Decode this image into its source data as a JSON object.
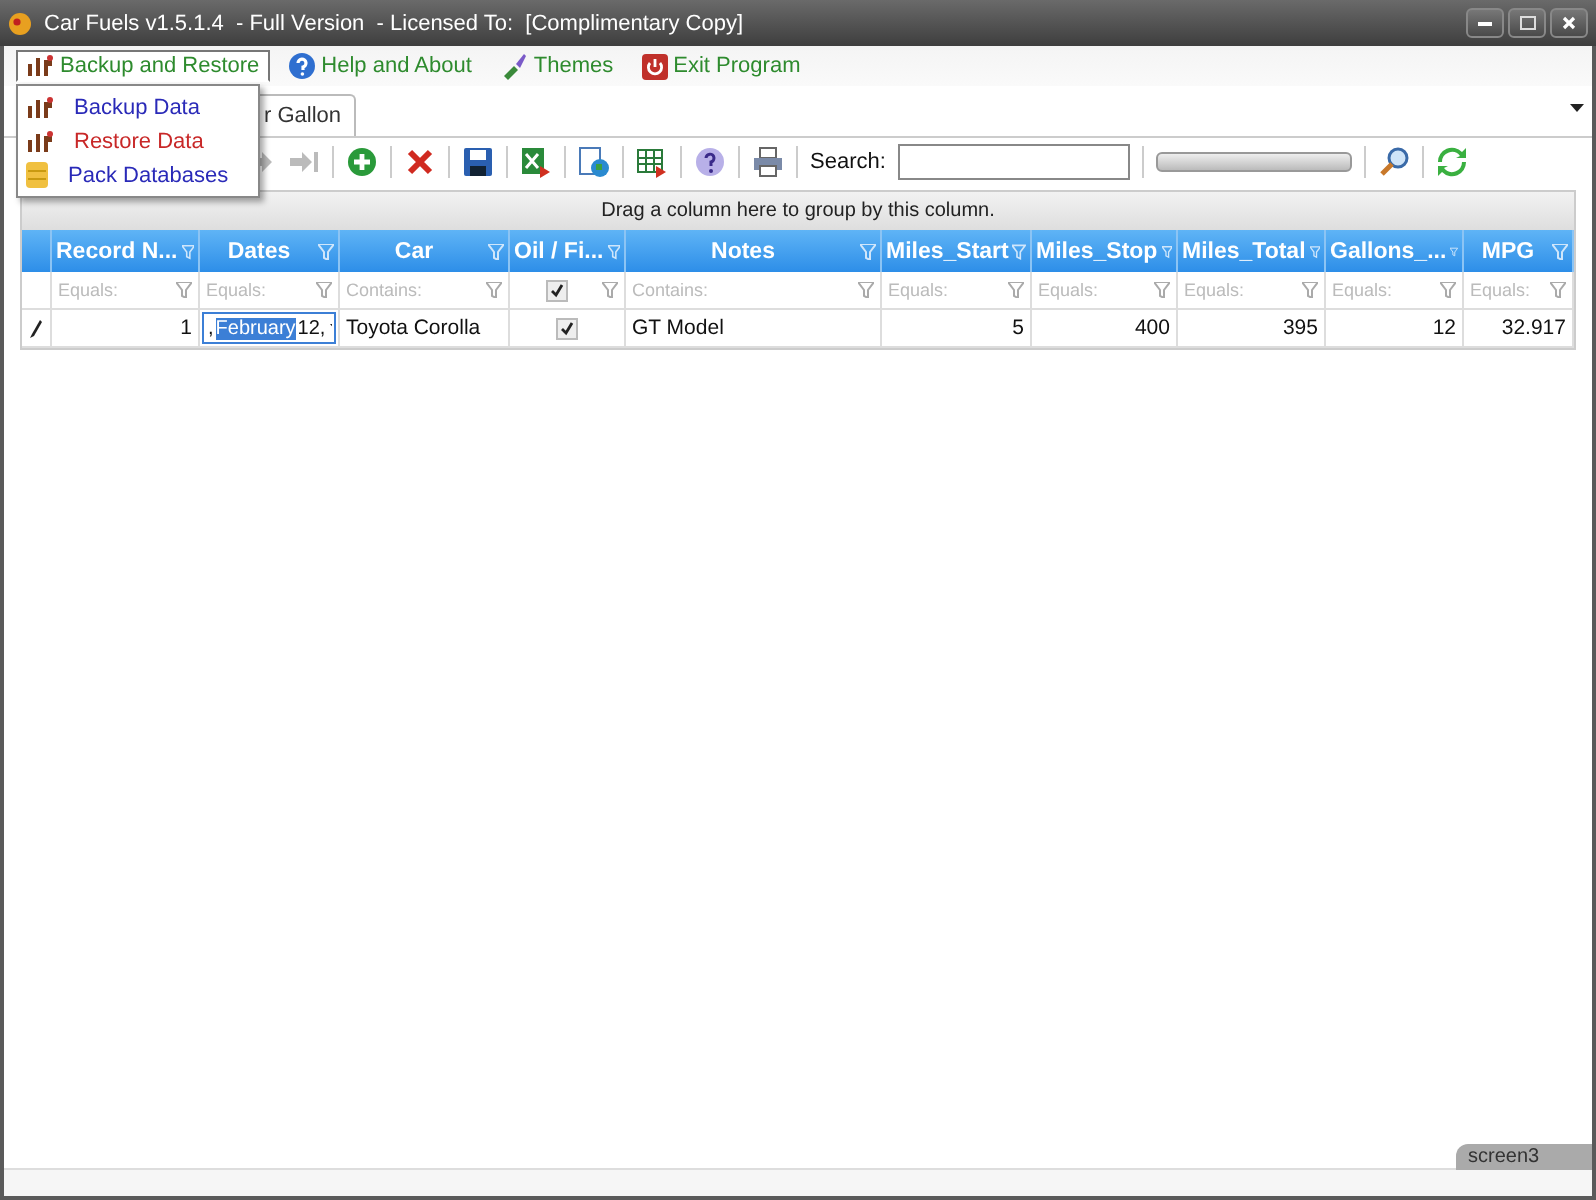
{
  "window": {
    "title": "Car Fuels v1.5.1.4  - Full Version  - Licensed To:  [Complimentary Copy]"
  },
  "menu": [
    {
      "label": "Backup and Restore",
      "selected": true
    },
    {
      "label": "Help and About",
      "selected": false
    },
    {
      "label": "Themes",
      "selected": false
    },
    {
      "label": "Exit Program",
      "selected": false
    }
  ],
  "dropdown": [
    {
      "label": "Backup Data",
      "color": "#2a2ab8"
    },
    {
      "label": "Restore Data",
      "color": "#c82828"
    },
    {
      "label": "Pack Databases",
      "color": "#2a2ab8"
    }
  ],
  "tabs": [
    {
      "label": "r Gallon",
      "selected": true
    }
  ],
  "toolbar": {
    "search_label": "Search:",
    "progress": {
      "level": 0
    }
  },
  "group_panel": {
    "hint": "Drag a column here to group by this column."
  },
  "columns": [
    {
      "label": "Record  N...",
      "filter": "Equals:",
      "kind": "number"
    },
    {
      "label": "Dates",
      "filter": "Equals:",
      "kind": "text"
    },
    {
      "label": "Car",
      "filter": "Contains:",
      "kind": "text"
    },
    {
      "label": "Oil / Fi...",
      "kind": "check",
      "checked": true
    },
    {
      "label": "Notes",
      "filter": "Contains:",
      "kind": "text"
    },
    {
      "label": "Miles_Start",
      "filter": "Equals:",
      "kind": "number"
    },
    {
      "label": "Miles_Stop",
      "filter": "Equals:",
      "kind": "number"
    },
    {
      "label": "Miles_Total",
      "filter": "Equals:",
      "kind": "number"
    },
    {
      "label": "Gallons_...",
      "filter": "Equals:",
      "kind": "number"
    },
    {
      "label": "MPG",
      "filter": "Equals:",
      "kind": "number"
    }
  ],
  "rows": [
    {
      "editing": true,
      "cells": [
        {
          "kind": "text",
          "value": "1"
        },
        {
          "kind": "date_editor",
          "before": ",",
          "selected_text": "February",
          "after": "12,"
        },
        {
          "kind": "text",
          "value": "Toyota Corolla"
        },
        {
          "kind": "check",
          "checked": true
        },
        {
          "kind": "text",
          "value": "GT Model"
        },
        {
          "kind": "text",
          "value": "5"
        },
        {
          "kind": "text",
          "value": "400"
        },
        {
          "kind": "text",
          "value": "395"
        },
        {
          "kind": "text",
          "value": "12"
        },
        {
          "kind": "text",
          "value": "32.917"
        }
      ]
    }
  ],
  "screen_tab": {
    "label": "screen3"
  }
}
